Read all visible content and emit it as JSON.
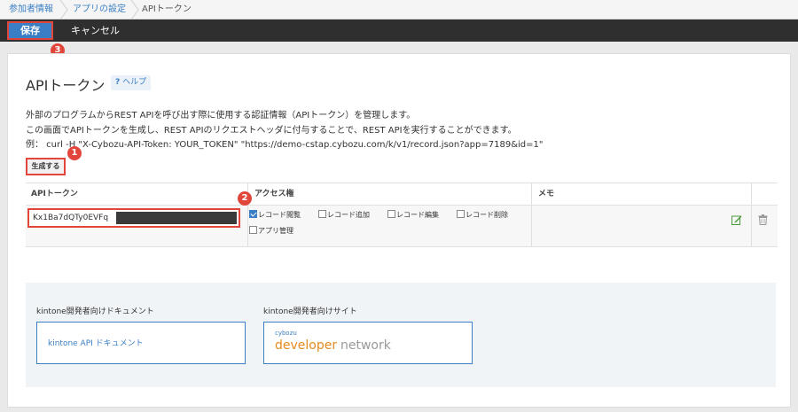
{
  "breadcrumb": {
    "items": [
      "参加者情報",
      "アプリの設定",
      "APIトークン"
    ]
  },
  "toolbar": {
    "save_label": "保存",
    "cancel_label": "キャンセル"
  },
  "markers": [
    "1",
    "2",
    "3"
  ],
  "page": {
    "title": "APIトークン",
    "help_icon": "?",
    "help_label": "ヘルプ",
    "desc_line1": "外部のプログラムからREST APIを呼び出す際に使用する認証情報（APIトークン）を管理します。",
    "desc_line2": "この画面でAPIトークンを生成し、REST APIのリクエストヘッダに付与することで、REST APIを実行することができます。",
    "desc_line3": "例： curl -H \"X-Cybozu-API-Token: YOUR_TOKEN\" \"https://demo-cstap.cybozu.com/k/v1/record.json?app=7189&id=1\"",
    "generate_label": "生成する"
  },
  "table": {
    "headers": {
      "token": "APIトークン",
      "access": "アクセス権",
      "memo": "メモ"
    },
    "row": {
      "token_value": "Kx1Ba7dQTy0EVFq",
      "permissions": [
        {
          "label": "レコード閲覧",
          "checked": true
        },
        {
          "label": "レコード追加",
          "checked": false
        },
        {
          "label": "レコード編集",
          "checked": false
        },
        {
          "label": "レコード削除",
          "checked": false
        },
        {
          "label": "アプリ管理",
          "checked": false
        }
      ],
      "memo": ""
    }
  },
  "developer": {
    "docs_heading": "kintone開発者向けドキュメント",
    "docs_link": "kintone API ドキュメント",
    "site_heading": "kintone開発者向けサイト",
    "logo_small": "cybozu",
    "logo_developer": "developer",
    "logo_network": "network"
  },
  "colors": {
    "accent": "#3a7ec5",
    "marker": "#e2463b",
    "toolbar": "#2f2f2f"
  }
}
